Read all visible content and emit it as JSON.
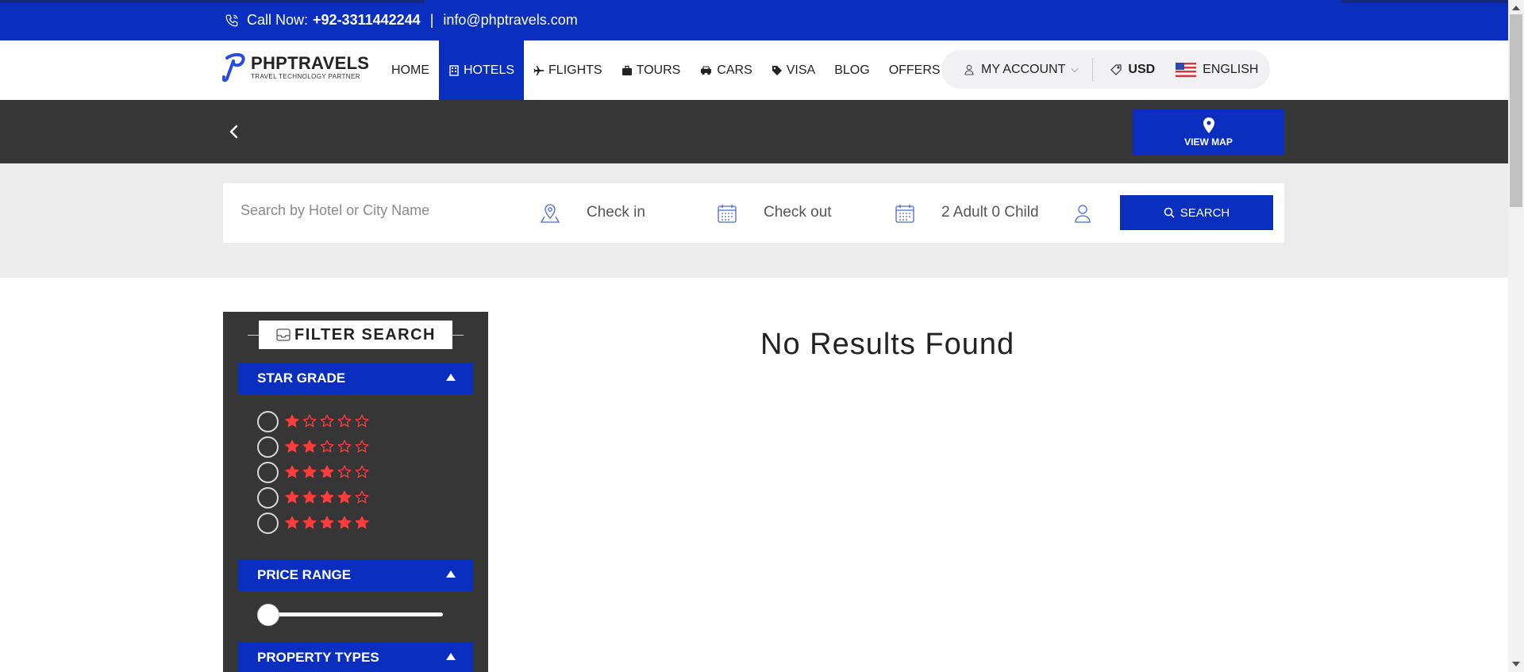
{
  "topbar": {
    "call_label": "Call Now:",
    "phone": "+92-3311442244",
    "separator": "|",
    "email": "info@phptravels.com"
  },
  "brand": {
    "name": "PHPTRAVELS",
    "tagline": "TRAVEL TECHNOLOGY PARTNER",
    "color": "#0a2fbf"
  },
  "nav": {
    "items": [
      {
        "label": "Home",
        "icon": "",
        "active": false
      },
      {
        "label": "Hotels",
        "icon": "hotel-icon",
        "active": true
      },
      {
        "label": "Flights",
        "icon": "plane-icon",
        "active": false
      },
      {
        "label": "Tours",
        "icon": "briefcase-icon",
        "active": false
      },
      {
        "label": "Cars",
        "icon": "car-icon",
        "active": false
      },
      {
        "label": "Visa",
        "icon": "tag-icon",
        "active": false
      },
      {
        "label": "Blog",
        "icon": "",
        "active": false
      },
      {
        "label": "Offers",
        "icon": "",
        "active": false
      }
    ],
    "account_label": "MY ACCOUNT",
    "currency": "USD",
    "language": "ENGLISH"
  },
  "subbar": {
    "view_map_label": "VIEW MAP"
  },
  "search": {
    "placeholder": "Search by Hotel or City Name",
    "checkin": "Check in",
    "checkout": "Check out",
    "guests": "2 Adult 0 Child",
    "button_label": "SEARCH"
  },
  "filter": {
    "title": "FILTER SEARCH",
    "sections": {
      "star_grade": "STAR GRADE",
      "price_range": "PRICE RANGE",
      "property_types": "PROPERTY TYPES"
    },
    "star_options": [
      1,
      2,
      3,
      4,
      5
    ],
    "price_slider_value": 0,
    "star_color": "#ff3b3b"
  },
  "results": {
    "message": "No Results Found"
  },
  "colors": {
    "primary": "#0a2fbf",
    "dark_bar": "#363636",
    "search_band": "#ececec"
  }
}
